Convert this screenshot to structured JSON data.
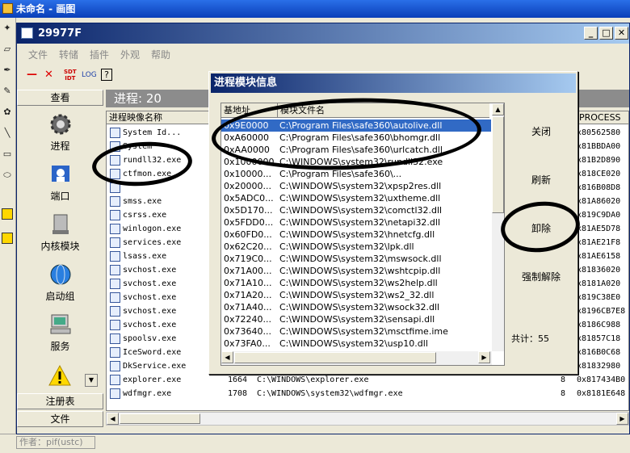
{
  "paint": {
    "title": "未命名 - 画图",
    "status": "作者：pif(ustc)"
  },
  "app": {
    "title": "29977F",
    "menu": [
      "文件",
      "转储",
      "插件",
      "外观",
      "帮助"
    ],
    "toolbar": {
      "log": "LOG",
      "help": "?"
    },
    "nav": {
      "header": "查看",
      "items": [
        {
          "label": "进程",
          "icon": "gear-icon"
        },
        {
          "label": "端口",
          "icon": "network-port-icon"
        },
        {
          "label": "内核模块",
          "icon": "chip-module-icon"
        },
        {
          "label": "启动组",
          "icon": "globe-icon"
        },
        {
          "label": "服务",
          "icon": "computer-icon"
        }
      ],
      "bottom": [
        "注册表",
        "文件"
      ]
    },
    "progress_header": "进程: 20",
    "columns": [
      "进程映像名称",
      "",
      "",
      "PROCESS"
    ],
    "processes": [
      {
        "name": "System Id...",
        "pid": "",
        "path": "",
        "thr": "",
        "addr": "x80562580"
      },
      {
        "name": "System",
        "pid": "",
        "path": "",
        "thr": "",
        "addr": "x81BBDA00"
      },
      {
        "name": "rundll32.exe",
        "pid": "",
        "path": "",
        "thr": "",
        "addr": "x81B2D890"
      },
      {
        "name": "ctfmon.exe",
        "pid": "",
        "path": "",
        "thr": "",
        "addr": "x818CE020"
      },
      {
        "name": "",
        "pid": "",
        "path": "",
        "thr": "",
        "addr": "x816B08D8"
      },
      {
        "name": "smss.exe",
        "pid": "",
        "path": "",
        "thr": "",
        "addr": "x81A86020"
      },
      {
        "name": "csrss.exe",
        "pid": "",
        "path": "",
        "thr": "",
        "addr": "x819C9DA0"
      },
      {
        "name": "winlogon.exe",
        "pid": "",
        "path": "",
        "thr": "",
        "addr": "x81AE5D78"
      },
      {
        "name": "services.exe",
        "pid": "",
        "path": "",
        "thr": "",
        "addr": "x81AE21F8"
      },
      {
        "name": "lsass.exe",
        "pid": "",
        "path": "",
        "thr": "",
        "addr": "x81AE6158"
      },
      {
        "name": "svchost.exe",
        "pid": "",
        "path": "",
        "thr": "",
        "addr": "x81836020"
      },
      {
        "name": "svchost.exe",
        "pid": "",
        "path": "",
        "thr": "",
        "addr": "x8181A020"
      },
      {
        "name": "svchost.exe",
        "pid": "",
        "path": "",
        "thr": "",
        "addr": "x819C38E0"
      },
      {
        "name": "svchost.exe",
        "pid": "",
        "path": "",
        "thr": "",
        "addr": "x8196CB7E8"
      },
      {
        "name": "svchost.exe",
        "pid": "",
        "path": "",
        "thr": "",
        "addr": "x8186C988"
      },
      {
        "name": "spoolsv.exe",
        "pid": "",
        "path": "",
        "thr": "",
        "addr": "x81857C18"
      },
      {
        "name": "IceSword.exe",
        "pid": "",
        "path": "",
        "thr": "",
        "addr": "x816B0C68"
      },
      {
        "name": "DkService.exe",
        "pid": "",
        "path": "",
        "thr": "",
        "addr": "x81832980"
      },
      {
        "name": "explorer.exe",
        "pid": "1664",
        "path": "C:\\WINDOWS\\explorer.exe",
        "thr": "8",
        "addr": "0x817434B0"
      },
      {
        "name": "wdfmgr.exe",
        "pid": "1708",
        "path": "C:\\WINDOWS\\system32\\wdfmgr.exe",
        "thr": "8",
        "addr": "0x8181E648"
      }
    ]
  },
  "dialog": {
    "title": "进程模块信息",
    "columns": [
      "基地址",
      "模块文件名"
    ],
    "modules": [
      {
        "base": "0x9E0000",
        "path": "C:\\Program Files\\safe360\\autolive.dll",
        "selected": true
      },
      {
        "base": "0xA60000",
        "path": "C:\\Program Files\\safe360\\bhomgr.dll"
      },
      {
        "base": "0xAA0000",
        "path": "C:\\Program Files\\safe360\\urlcatch.dll"
      },
      {
        "base": "0x1000000",
        "path": "C:\\WINDOWS\\system32\\rundll32.exe"
      },
      {
        "base": "0x10000...",
        "path": "C:\\Program Files\\safe360\\..."
      },
      {
        "base": "0x20000...",
        "path": "C:\\WINDOWS\\system32\\xpsp2res.dll"
      },
      {
        "base": "0x5ADC0...",
        "path": "C:\\WINDOWS\\system32\\uxtheme.dll"
      },
      {
        "base": "0x5D170...",
        "path": "C:\\WINDOWS\\system32\\comctl32.dll"
      },
      {
        "base": "0x5FDD0...",
        "path": "C:\\WINDOWS\\system32\\netapi32.dll"
      },
      {
        "base": "0x60FD0...",
        "path": "C:\\WINDOWS\\system32\\hnetcfg.dll"
      },
      {
        "base": "0x62C20...",
        "path": "C:\\WINDOWS\\system32\\lpk.dll"
      },
      {
        "base": "0x719C0...",
        "path": "C:\\WINDOWS\\system32\\mswsock.dll"
      },
      {
        "base": "0x71A00...",
        "path": "C:\\WINDOWS\\system32\\wshtcpip.dll"
      },
      {
        "base": "0x71A10...",
        "path": "C:\\WINDOWS\\system32\\ws2help.dll"
      },
      {
        "base": "0x71A20...",
        "path": "C:\\WINDOWS\\system32\\ws2_32.dll"
      },
      {
        "base": "0x71A40...",
        "path": "C:\\WINDOWS\\system32\\wsock32.dll"
      },
      {
        "base": "0x72240...",
        "path": "C:\\WINDOWS\\system32\\sensapi.dll"
      },
      {
        "base": "0x73640...",
        "path": "C:\\WINDOWS\\system32\\msctfime.ime"
      },
      {
        "base": "0x73FA0...",
        "path": "C:\\WINDOWS\\system32\\usp10.dll"
      }
    ],
    "buttons": {
      "close": "关闭",
      "refresh": "刷新",
      "unload": "卸除",
      "force_unload": "强制解除"
    },
    "total": "共计：55"
  }
}
